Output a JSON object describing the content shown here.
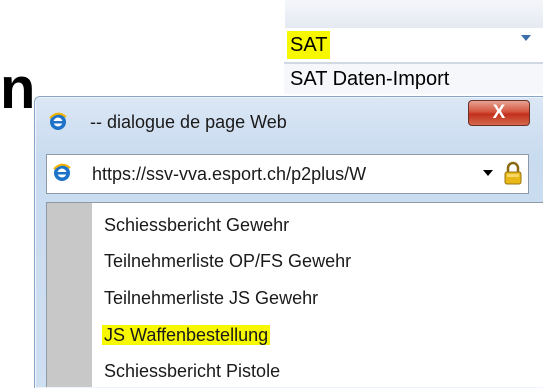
{
  "background": {
    "big_letter": "n",
    "select": {
      "value": "SAT",
      "options": [
        "SAT Daten-Import"
      ]
    },
    "colors": {
      "highlight": "#f7f700"
    }
  },
  "dialog": {
    "title": "-- dialogue de page Web",
    "title_icon": "ie-icon",
    "close_label": "X",
    "address": {
      "url": "https://ssv-vva.esport.ch/p2plus/W",
      "icon": "ie-icon",
      "secure_icon": "lock-icon"
    },
    "menu": {
      "items": [
        {
          "label": "Schiessbericht Gewehr",
          "highlighted": false
        },
        {
          "label": "Teilnehmerliste OP/FS Gewehr",
          "highlighted": false
        },
        {
          "label": "Teilnehmerliste JS Gewehr",
          "highlighted": false
        },
        {
          "label": "JS Waffenbestellung",
          "highlighted": true
        },
        {
          "label": "Schiessbericht Pistole",
          "highlighted": false
        }
      ]
    }
  }
}
